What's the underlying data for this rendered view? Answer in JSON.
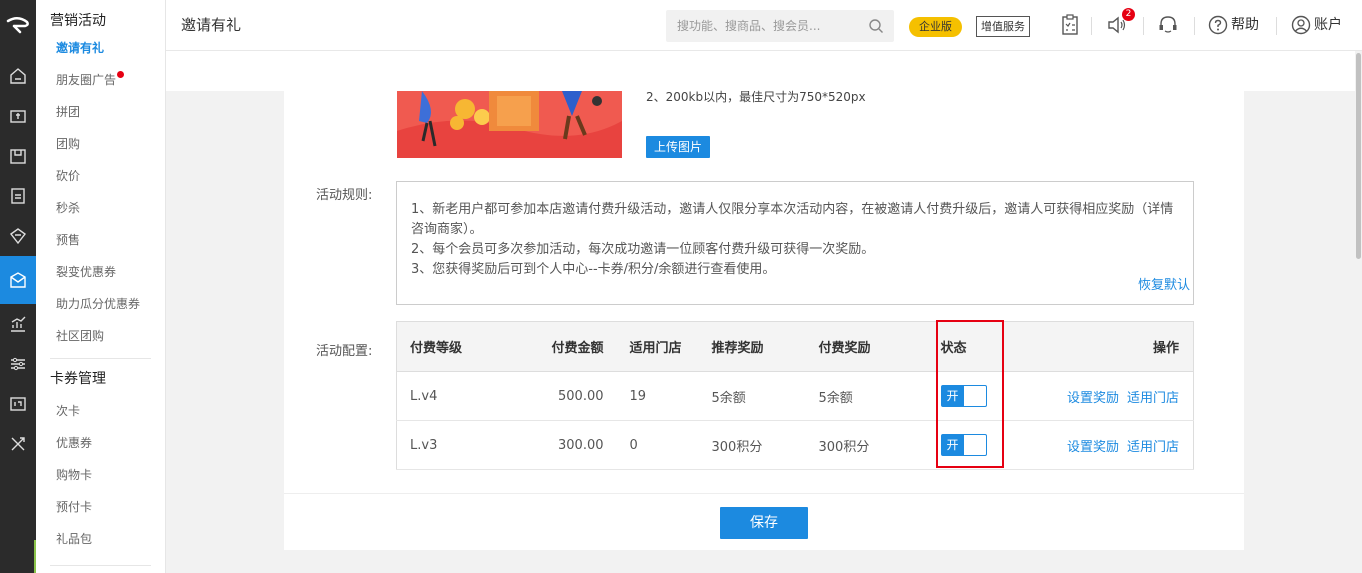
{
  "sidebar": {
    "groups": [
      {
        "title": "营销活动",
        "items": [
          {
            "label": "邀请有礼",
            "active": true
          },
          {
            "label": "朋友圈广告",
            "dot": true
          },
          {
            "label": "拼团"
          },
          {
            "label": "团购"
          },
          {
            "label": "砍价"
          },
          {
            "label": "秒杀"
          },
          {
            "label": "预售"
          },
          {
            "label": "裂变优惠券"
          },
          {
            "label": "助力瓜分优惠券"
          },
          {
            "label": "社区团购"
          }
        ]
      },
      {
        "title": "卡券管理",
        "items": [
          {
            "label": "次卡"
          },
          {
            "label": "优惠券"
          },
          {
            "label": "购物卡"
          },
          {
            "label": "预付卡"
          },
          {
            "label": "礼品包"
          }
        ]
      }
    ]
  },
  "header": {
    "title": "邀请有礼",
    "search_placeholder": "搜功能、搜商品、搜会员...",
    "edition_badge": "企业版",
    "value_added": "增值服务",
    "notification_count": "2",
    "help": "帮助",
    "account": "账户"
  },
  "image_upload": {
    "hint": "2、200kb以内，最佳尺寸为750*520px",
    "button": "上传图片"
  },
  "rules": {
    "label": "活动规则:",
    "text": [
      "1、新老用户都可参加本店邀请付费升级活动，邀请人仅限分享本次活动内容，在被邀请人付费升级后，邀请人可获得相应奖励（详情咨询商家）。",
      "2、每个会员可多次参加活动，每次成功邀请一位顾客付费升级可获得一次奖励。",
      "3、您获得奖励后可到个人中心--卡券/积分/余额进行查看使用。"
    ],
    "restore": "恢复默认"
  },
  "config": {
    "label": "活动配置:",
    "columns": [
      "付费等级",
      "付费金额",
      "适用门店",
      "推荐奖励",
      "付费奖励",
      "状态",
      "操作"
    ],
    "rows": [
      {
        "level": "L.v4",
        "amount": "500.00",
        "stores": "19",
        "referral": "5余额",
        "paid": "5余额",
        "status": "开",
        "action1": "设置奖励",
        "action2": "适用门店"
      },
      {
        "level": "L.v3",
        "amount": "300.00",
        "stores": "0",
        "referral": "300积分",
        "paid": "300积分",
        "status": "开",
        "action1": "设置奖励",
        "action2": "适用门店"
      }
    ]
  },
  "save_button": "保存",
  "colors": {
    "primary": "#1c8ae0",
    "highlight": "#e60012",
    "badge": "#f5c000"
  },
  "icons": [
    "logo-icon",
    "home-icon",
    "cashier-icon",
    "goods-icon",
    "member-icon",
    "marketing-icon",
    "promotion-icon",
    "chart-icon",
    "settings-icon",
    "terminal-icon",
    "tools-icon",
    "search-icon",
    "clipboard-icon",
    "speaker-icon",
    "headset-icon",
    "help-icon",
    "user-icon"
  ]
}
